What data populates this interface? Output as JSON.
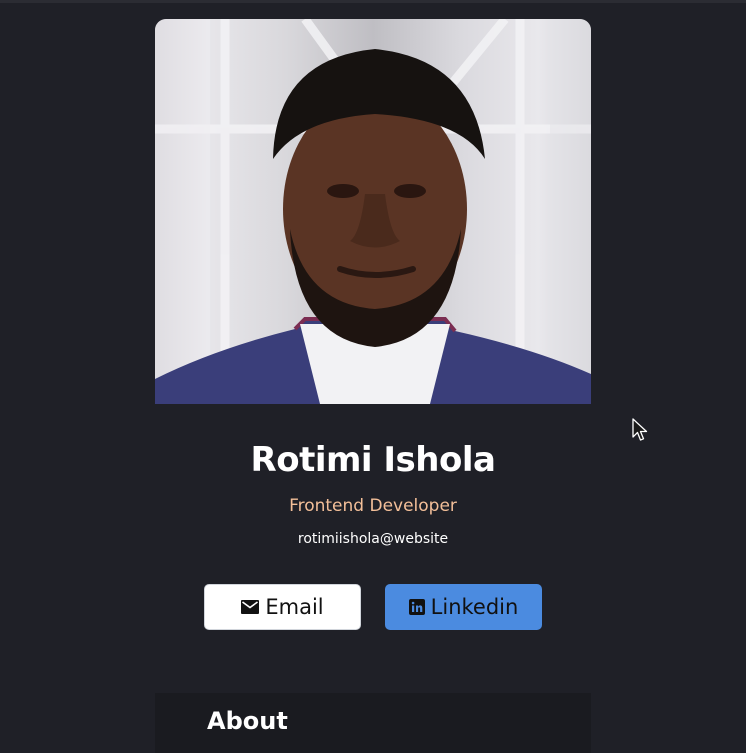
{
  "profile": {
    "name": "Rotimi Ishola",
    "role": "Frontend Developer",
    "handle": "rotimiishola@website"
  },
  "buttons": {
    "email_label": "Email",
    "email_icon": "mail-icon",
    "linkedin_label": "Linkedin",
    "linkedin_icon": "linkedin-icon"
  },
  "about": {
    "title": "About"
  },
  "colors": {
    "background": "#1f2027",
    "role_accent": "#f3bf99",
    "linkedin_button": "#4b8be0",
    "email_button": "#ffffff"
  }
}
